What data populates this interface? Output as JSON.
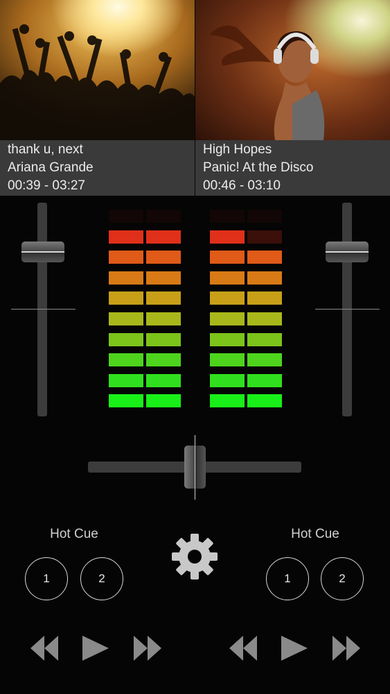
{
  "deck_a": {
    "title": "thank u, next",
    "artist": "Ariana Grande",
    "time": "00:39 - 03:27",
    "volume_level": 0.78
  },
  "deck_b": {
    "title": "High Hopes",
    "artist": "Panic! At the Disco",
    "time": "00:46 - 03:10",
    "volume_level": 0.78
  },
  "meters": {
    "deck_a_left_lit": 9,
    "deck_a_right_lit": 9,
    "deck_b_left_lit": 9,
    "deck_b_right_lit": 8,
    "segment_colors": [
      "#3a0a0a",
      "#e0301a",
      "#e05a18",
      "#d87a16",
      "#c8a018",
      "#a8b81a",
      "#7cc41a",
      "#4ed41c",
      "#30e01e",
      "#18f018"
    ]
  },
  "crossfader": {
    "position": 0.5
  },
  "hot_cue": {
    "left_label": "Hot Cue",
    "right_label": "Hot Cue",
    "left_buttons": [
      "1",
      "2"
    ],
    "right_buttons": [
      "1",
      "2"
    ]
  },
  "icons": {
    "settings": "gear-icon",
    "rewind": "rewind-icon",
    "play": "play-icon",
    "forward": "fast-forward-icon"
  }
}
